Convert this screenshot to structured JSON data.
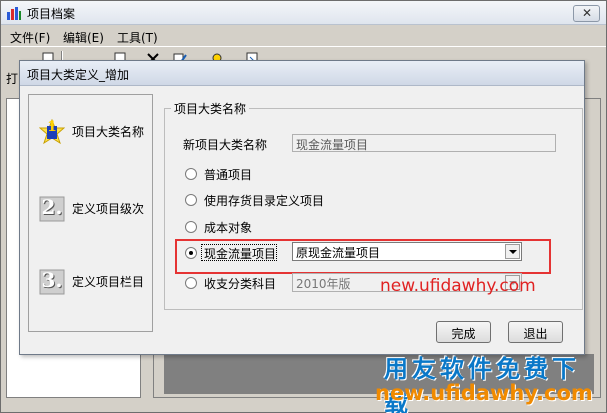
{
  "window": {
    "title": "项目档案",
    "close_glyph": "✕"
  },
  "menu": [
    "文件(F)",
    "编辑(E)",
    "工具(T)"
  ],
  "toolbar": {
    "print_label": "打"
  },
  "left_panel": {
    "bottom_text": ""
  },
  "dialog": {
    "title": "项目大类定义_增加",
    "steps": [
      {
        "num": "1",
        "label": "项目大类名称",
        "active": true
      },
      {
        "num": "2.",
        "label": "定义项目级次",
        "active": false
      },
      {
        "num": "3.",
        "label": "定义项目栏目",
        "active": false
      }
    ],
    "group_title": "项目大类名称",
    "new_name_label": "新项目大类名称",
    "new_name_value": "现金流量项目",
    "options": [
      {
        "label": "普通项目",
        "selected": false
      },
      {
        "label": "使用存货目录定义项目",
        "selected": false
      },
      {
        "label": "成本对象",
        "selected": false
      },
      {
        "label": "现金流量项目",
        "selected": true
      },
      {
        "label": "收支分类科目",
        "selected": false
      }
    ],
    "cashflow_combo_value": "原现金流量项目",
    "budget_combo_value": "2010年版",
    "finish_button": "完成",
    "exit_button": "退出"
  },
  "watermark": {
    "url_red": "new.ufidawhy.com",
    "banner": "用友软件免费下载",
    "url_orange": "new.ufidawhy.com"
  },
  "colors": {
    "highlight": "#e53333",
    "watermark_blue": "#0a78c8",
    "watermark_orange": "#f08a00"
  }
}
